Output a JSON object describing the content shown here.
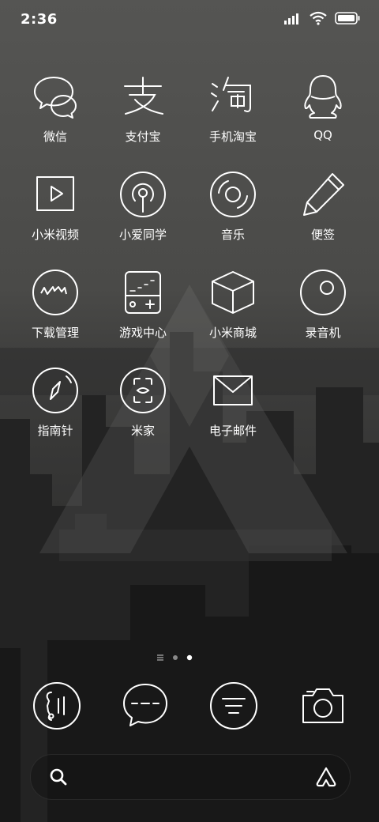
{
  "status_bar": {
    "time": "2:36",
    "icons": [
      "signal-icon",
      "wifi-icon",
      "battery-icon"
    ]
  },
  "home_grid": [
    {
      "label": "微信",
      "icon": "wechat-icon"
    },
    {
      "label": "支付宝",
      "icon": "alipay-icon"
    },
    {
      "label": "手机淘宝",
      "icon": "taobao-icon"
    },
    {
      "label": "QQ",
      "icon": "qq-icon"
    },
    {
      "label": "小米视频",
      "icon": "video-icon"
    },
    {
      "label": "小爱同学",
      "icon": "xiaoai-icon"
    },
    {
      "label": "音乐",
      "icon": "music-icon"
    },
    {
      "label": "便签",
      "icon": "notes-icon"
    },
    {
      "label": "下载管理",
      "icon": "download-icon"
    },
    {
      "label": "游戏中心",
      "icon": "game-center-icon"
    },
    {
      "label": "小米商城",
      "icon": "mi-store-icon"
    },
    {
      "label": "录音机",
      "icon": "recorder-icon"
    },
    {
      "label": "指南针",
      "icon": "compass-icon"
    },
    {
      "label": "米家",
      "icon": "mijia-icon"
    },
    {
      "label": "电子邮件",
      "icon": "email-icon"
    }
  ],
  "page_indicator": {
    "pages": 2,
    "current": 2
  },
  "dock": [
    "phone-icon",
    "messages-icon",
    "settings-icon",
    "camera-icon"
  ],
  "search_bar": {
    "icons": [
      "search-icon",
      "assistant-icon"
    ]
  }
}
